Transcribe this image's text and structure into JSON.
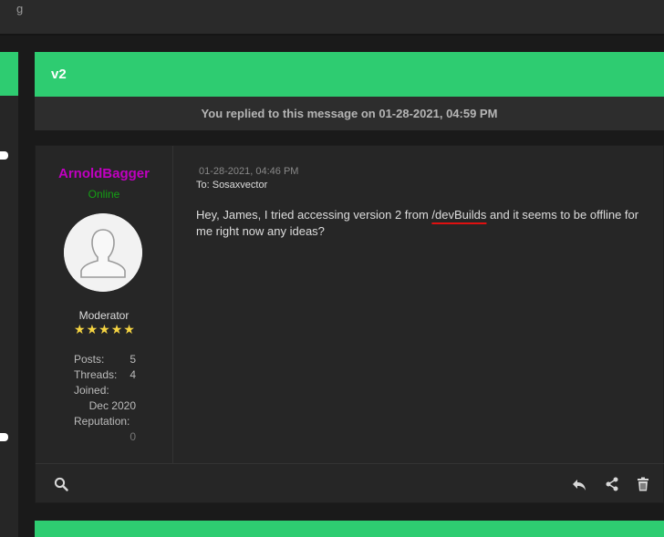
{
  "topbar": {
    "crumb": "g"
  },
  "thread": {
    "title": "v2",
    "replied_notice": "You replied to this message on 01-28-2021, 04:59 PM"
  },
  "author": {
    "username": "ArnoldBagger",
    "status": "Online",
    "role": "Moderator",
    "stars": 5,
    "posts_label": "Posts:",
    "posts_value": "5",
    "threads_label": "Threads:",
    "threads_value": "4",
    "joined_label": "Joined:",
    "joined_value": "Dec 2020",
    "reputation_label": "Reputation:",
    "reputation_value": "0"
  },
  "message": {
    "date": "01-28-2021, 04:46 PM",
    "to": "To: Sosaxvector",
    "body_before": "Hey, James, I tried accessing version 2 from ",
    "body_link": "/devBuilds",
    "body_after": " and it seems to be offline for me right now any ideas?"
  },
  "footer_icons": [
    "search-icon",
    "reply-icon",
    "share-icon",
    "trash-icon"
  ],
  "colors": {
    "accent_green": "#2ecc71",
    "username": "#c000c0",
    "online": "#14a014",
    "star": "#f5d442",
    "spell_underline": "#e01010"
  }
}
